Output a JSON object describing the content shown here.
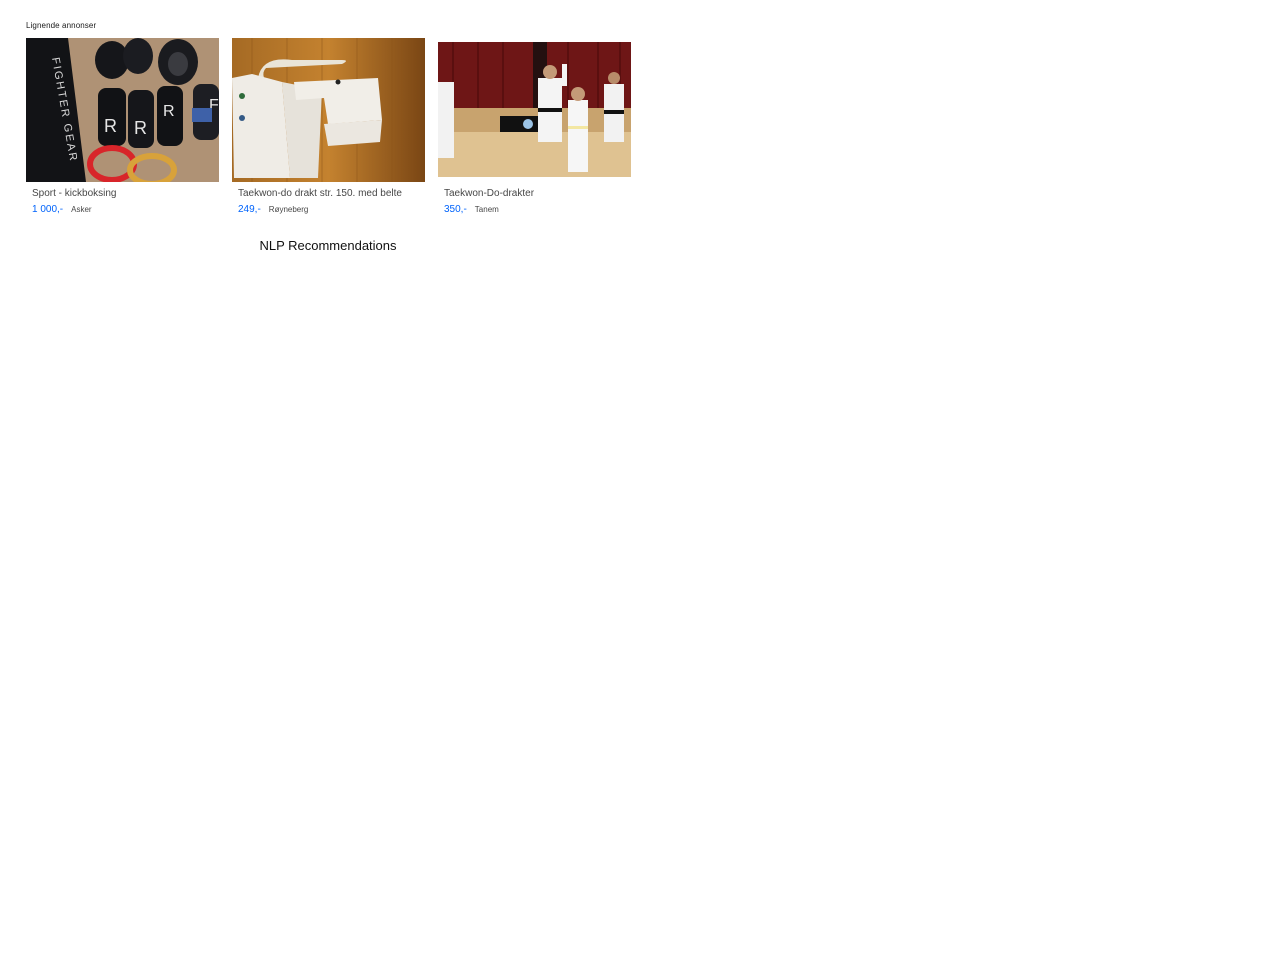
{
  "section": {
    "title": "Lignende annonser"
  },
  "listings": [
    {
      "title": "Sport - kickboksing",
      "price": "1 000,-",
      "location": "Asker",
      "image_icon": "kickboxing-gear-photo"
    },
    {
      "title": "Taekwon-do drakt str. 150. med belte",
      "price": "249,-",
      "location": "Røyneberg",
      "image_icon": "taekwondo-uniform-photo"
    },
    {
      "title": "Taekwon-Do-drakter",
      "price": "350,-",
      "location": "Tanem",
      "image_icon": "taekwondo-class-photo"
    }
  ],
  "footer": {
    "title": "NLP Recommendations"
  },
  "colors": {
    "price": "#0063fb",
    "text": "#474747",
    "heading": "#1a1a1a"
  }
}
